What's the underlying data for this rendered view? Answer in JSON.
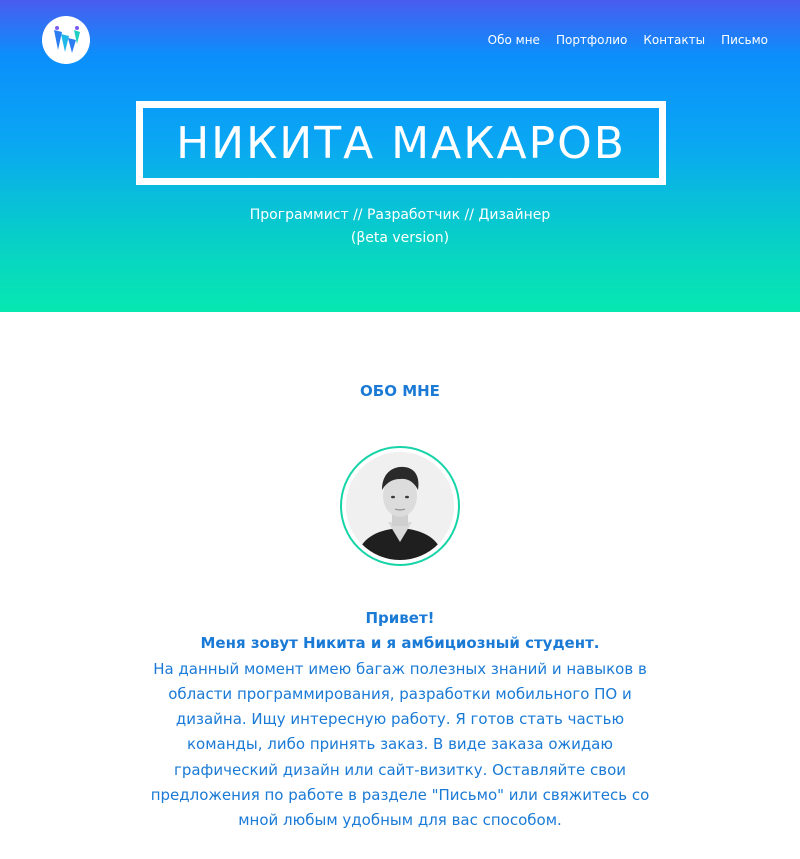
{
  "nav": {
    "items": [
      "Обо мне",
      "Портфолио",
      "Контакты",
      "Письмо"
    ]
  },
  "hero": {
    "name": "НИКИТА МАКАРОВ",
    "subtitle": "Программист // Разработчик // Дизайнер",
    "version": "(βeta version)"
  },
  "about": {
    "title": "ОБО МНЕ",
    "greeting": "Привет!",
    "intro": "Меня зовут Никита и я амбициозный студент.",
    "body": "На данный момент имею багаж полезных знаний и навыков в области программирования, разработки мобильного ПО и дизайна. Ищу интересную работу. Я готов стать частью команды, либо принять заказ. В виде заказа ожидаю графический дизайн или сайт-визитку. Оставляйте свои предложения по работе в разделе \"Письмо\" или свяжитесь со мной любым удобным для вас способом."
  },
  "icons": {
    "logo": "brand-logo-icon",
    "avatar": "profile-photo"
  },
  "colors": {
    "accent": "#1a7ad6",
    "hero_top": "#0b8ffb",
    "hero_bottom": "#06e8b0",
    "avatar_ring": "#16d4a8"
  }
}
